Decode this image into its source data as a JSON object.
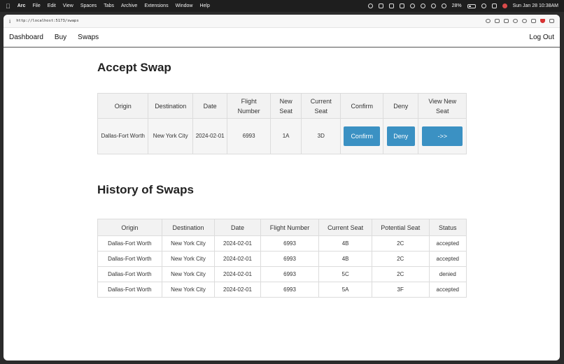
{
  "menubar": {
    "app": "Arc",
    "menus": [
      "File",
      "Edit",
      "View",
      "Spaces",
      "Tabs",
      "Archive",
      "Extensions",
      "Window",
      "Help"
    ],
    "battery": "28%",
    "datetime": "Sun Jan 28  10:38AM"
  },
  "browser": {
    "url": "http://localhost:5173/swaps"
  },
  "nav": {
    "dashboard": "Dashboard",
    "buy": "Buy",
    "swaps": "Swaps",
    "logout": "Log Out"
  },
  "accept": {
    "title": "Accept Swap",
    "headers": [
      "Origin",
      "Destination",
      "Date",
      "Flight Number",
      "New Seat",
      "Current Seat",
      "Confirm",
      "Deny",
      "View New Seat"
    ],
    "row": {
      "origin": "Dallas-Fort Worth",
      "destination": "New York City",
      "date": "2024-02-01",
      "flight": "6993",
      "new_seat": "1A",
      "current_seat": "3D",
      "confirm_label": "Confirm",
      "deny_label": "Deny",
      "view_label": "->>"
    }
  },
  "history": {
    "title": "History of Swaps",
    "headers": [
      "Origin",
      "Destination",
      "Date",
      "Flight Number",
      "Current Seat",
      "Potential Seat",
      "Status"
    ],
    "rows": [
      [
        "Dallas-Fort Worth",
        "New York City",
        "2024-02-01",
        "6993",
        "4B",
        "2C",
        "accepted"
      ],
      [
        "Dallas-Fort Worth",
        "New York City",
        "2024-02-01",
        "6993",
        "4B",
        "2C",
        "accepted"
      ],
      [
        "Dallas-Fort Worth",
        "New York City",
        "2024-02-01",
        "6993",
        "5C",
        "2C",
        "denied"
      ],
      [
        "Dallas-Fort Worth",
        "New York City",
        "2024-02-01",
        "6993",
        "5A",
        "3F",
        "accepted"
      ]
    ]
  }
}
